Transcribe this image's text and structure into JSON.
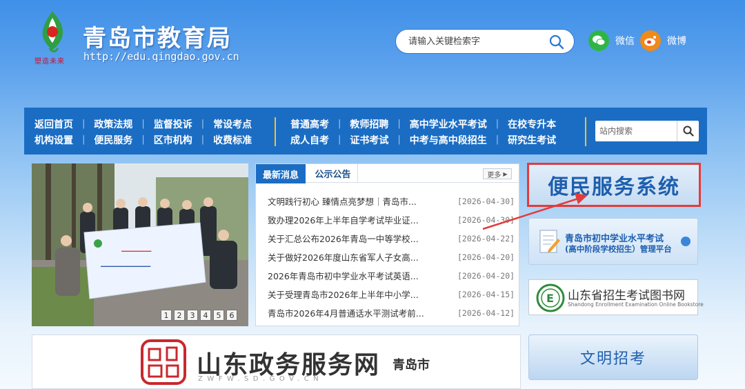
{
  "header": {
    "title": "青岛市教育局",
    "url": "http://edu.qingdao.gov.cn",
    "logo_motto": "塑造未来",
    "search_placeholder": "请输入关键检索字",
    "wechat_label": "微信",
    "weibo_label": "微博"
  },
  "nav": {
    "left": [
      [
        "返回首页",
        "政策法规",
        "监督投诉",
        "常设考点"
      ],
      [
        "机构设置",
        "便民服务",
        "区市机构",
        "收费标准"
      ]
    ],
    "right": [
      [
        "普通高考",
        "教师招聘",
        "高中学业水平考试",
        "在校专升本"
      ],
      [
        "成人自考",
        "证书考试",
        "中考与高中段招生",
        "研究生考试"
      ]
    ],
    "site_search_placeholder": "站内搜索"
  },
  "slider": {
    "pages": [
      "1",
      "2",
      "3",
      "4",
      "5",
      "6"
    ]
  },
  "news": {
    "tab_latest": "最新消息",
    "tab_notice": "公示公告",
    "more": "更多",
    "items": [
      {
        "title": "文明践行初心 臻情点亮梦想｜青岛市...",
        "date": "[2026-04-30]"
      },
      {
        "title": "致办理2026年上半年自学考试毕业证...",
        "date": "[2026-04-30]"
      },
      {
        "title": "关于汇总公布2026年青岛一中等学校...",
        "date": "[2026-04-22]"
      },
      {
        "title": "关于做好2026年度山东省军人子女高...",
        "date": "[2026-04-20]"
      },
      {
        "title": "2026年青岛市初中学业水平考试英语...",
        "date": "[2026-04-20]"
      },
      {
        "title": "关于受理青岛市2026年上半年中小学...",
        "date": "[2026-04-15]"
      },
      {
        "title": "青岛市2026年4月普通话水平测试考前...",
        "date": "[2026-04-12]"
      }
    ]
  },
  "banners": {
    "bianmin": "便民服务系统",
    "chuzhong_line1": "青岛市初中学业水平考试",
    "chuzhong_line2": "(高中阶段学校招生）管理平台",
    "book_cn": "山东省招生考试图书网",
    "book_en": "Shandong Enrollment Examination Online Bookstore",
    "zwfw_title": "山东政务服务网",
    "zwfw_city": "青岛市",
    "zwfw_url": "ZWFW.SD.GOV.CN",
    "wenming": "文明招考"
  },
  "colors": {
    "nav_blue": "#1b6dc4",
    "accent_yellow": "#f4c22b",
    "highlight_red": "#e33b3b"
  }
}
